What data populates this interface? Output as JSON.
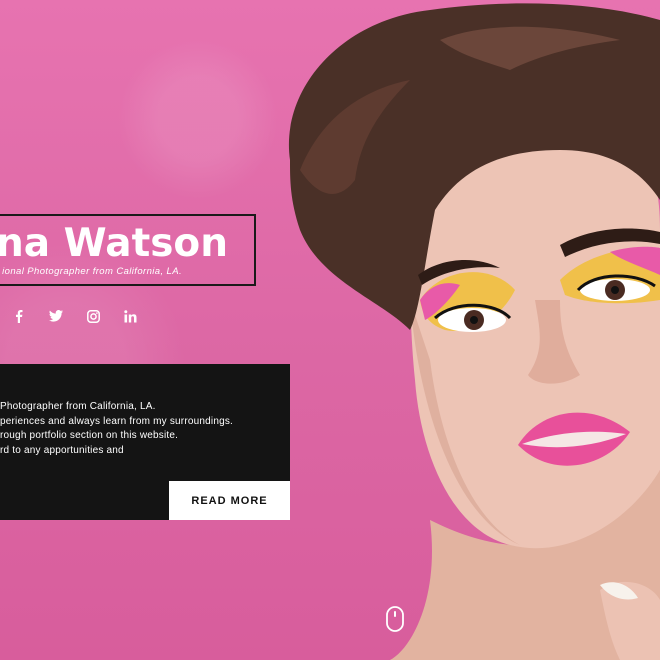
{
  "hero": {
    "name": "na Watson",
    "tagline": "ional Photographer from California, LA."
  },
  "social": [
    {
      "icon": "facebook-icon",
      "glyph": "f"
    },
    {
      "icon": "twitter-icon",
      "glyph": "t"
    },
    {
      "icon": "instagram-icon",
      "glyph": "ig"
    },
    {
      "icon": "linkedin-icon",
      "glyph": "in"
    }
  ],
  "about": {
    "lines": [
      "Photographer from California, LA.",
      "periences and always learn from my surroundings.",
      "rough portfolio section on this website.",
      "rd to any apportunities and"
    ],
    "button_label": "READ MORE"
  },
  "scroll": {
    "icon": "mouse-scroll-icon"
  },
  "colors": {
    "background": "#df6aa6",
    "panel": "#141414",
    "button": "#ffffff",
    "text": "#ffffff"
  }
}
